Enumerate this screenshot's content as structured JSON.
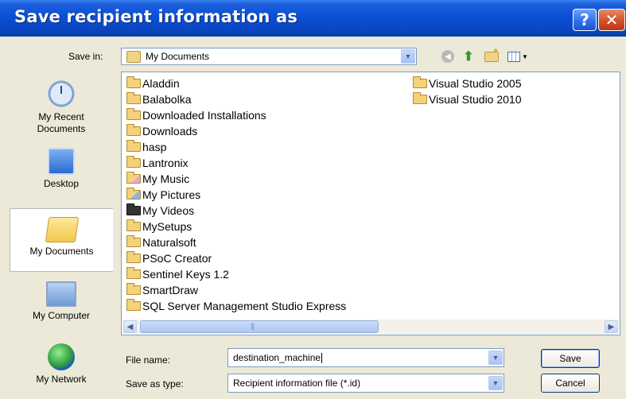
{
  "window": {
    "title": "Save recipient information as",
    "help_symbol": "?",
    "close_symbol": "✕"
  },
  "toolbar": {
    "save_in_label": "Save in:",
    "save_in_value": "My Documents",
    "icons": [
      "back-icon",
      "up-folder-icon",
      "new-folder-icon",
      "views-menu-icon"
    ]
  },
  "places": [
    {
      "label": "My Recent Documents",
      "icon": "recent-documents-icon"
    },
    {
      "label": "Desktop",
      "icon": "desktop-icon"
    },
    {
      "label": "My Documents",
      "icon": "my-documents-icon",
      "selected": true
    },
    {
      "label": "My Computer",
      "icon": "my-computer-icon"
    },
    {
      "label": "My Network",
      "icon": "my-network-icon"
    }
  ],
  "files": {
    "column1": [
      "Aladdin",
      "Balabolka",
      "Downloaded Installations",
      "Downloads",
      "hasp",
      "Lantronix",
      "My Music",
      "My Pictures",
      "My Videos",
      "MySetups",
      "Naturalsoft",
      "PSoC Creator",
      "Sentinel Keys 1.2",
      "SmartDraw",
      "SQL Server Management Studio Express"
    ],
    "column2": [
      "Visual Studio 2005",
      "Visual Studio 2010"
    ]
  },
  "form": {
    "file_name_label": "File name:",
    "file_name_value": "destination_machine",
    "save_as_type_label": "Save as type:",
    "save_as_type_value": "Recipient information file (*.id)",
    "save_button": "Save",
    "cancel_button": "Cancel"
  },
  "colors": {
    "titlebar": "#0a4fd6",
    "dialog_bg": "#ece9d8",
    "input_border": "#7f9db9"
  }
}
